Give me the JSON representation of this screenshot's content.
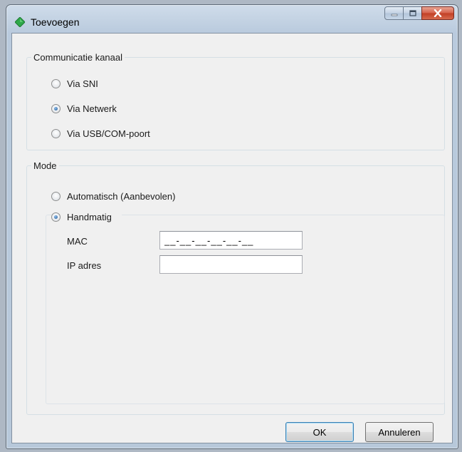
{
  "window": {
    "title": "Toevoegen",
    "icon": "green-diamond-icon",
    "controls": [
      "minimize-icon",
      "maximize-icon",
      "close-icon"
    ]
  },
  "channel_group": {
    "legend": "Communicatie kanaal",
    "options": [
      {
        "label": "Via SNI",
        "checked": false
      },
      {
        "label": "Via Netwerk",
        "checked": true
      },
      {
        "label": "Via USB/COM-poort",
        "checked": false
      }
    ]
  },
  "mode_group": {
    "legend": "Mode",
    "auto": {
      "label": "Automatisch (Aanbevolen)",
      "checked": false
    },
    "manual": {
      "label": "Handmatig",
      "checked": true,
      "mac": {
        "label": "MAC",
        "value": "__-__-__-__-__-__"
      },
      "ip": {
        "label": "IP adres",
        "value": ""
      }
    }
  },
  "buttons": {
    "ok": "OK",
    "cancel": "Annuleren"
  },
  "colors": {
    "accent": "#3c7fb1",
    "close": "#c13e24",
    "icon": "#2ea84a"
  }
}
